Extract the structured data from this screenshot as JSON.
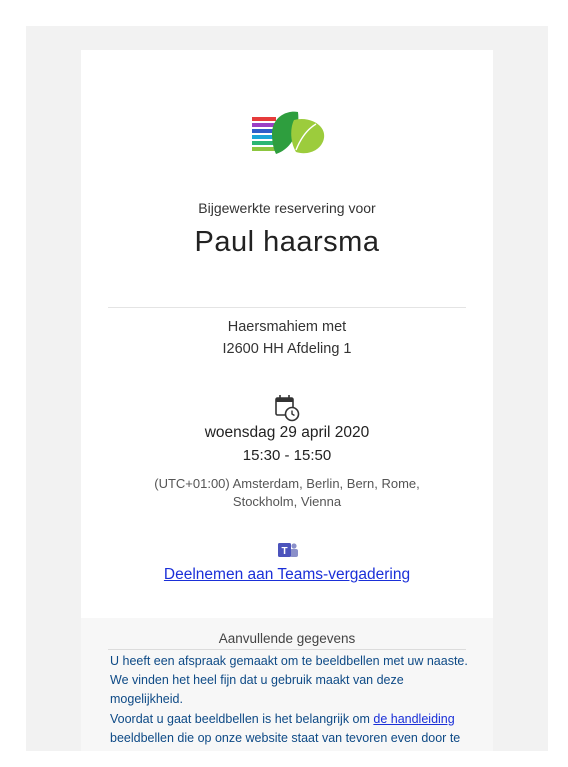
{
  "subtitle": "Bijgewerkte reservering voor",
  "name": "Paul haarsma",
  "location": {
    "line1": "Haersmahiem met",
    "line2": "I2600 HH Afdeling 1"
  },
  "schedule": {
    "date": "woensdag 29 april 2020",
    "time": "15:30 - 15:50",
    "timezone": "(UTC+01:00) Amsterdam, Berlin, Bern, Rome, Stockholm, Vienna"
  },
  "teams": {
    "link_label": "Deelnemen aan Teams-vergadering"
  },
  "additional": {
    "title": "Aanvullende gegevens",
    "para1": "U heeft een afspraak gemaakt om te beeldbellen met uw naaste. We vinden het heel fijn dat u gebruik maakt van deze mogelijkheid.",
    "para2_before": "Voordat u gaat beeldbellen is het belangrijk om ",
    "para2_link": "de handleiding",
    "para2_after": " beeldbellen die op onze website staat van tevoren even door te nemen. Hierin staat in eenvoudige"
  },
  "icons": {
    "logo": "organization-logo",
    "calendar": "calendar-clock-icon",
    "teams": "teams-icon"
  },
  "colors": {
    "link": "#1a2fd8",
    "body_text": "#0e4a86",
    "logo_green": "#6cbf3a",
    "logo_red": "#e63b3b",
    "logo_blue": "#2f5ec9"
  }
}
